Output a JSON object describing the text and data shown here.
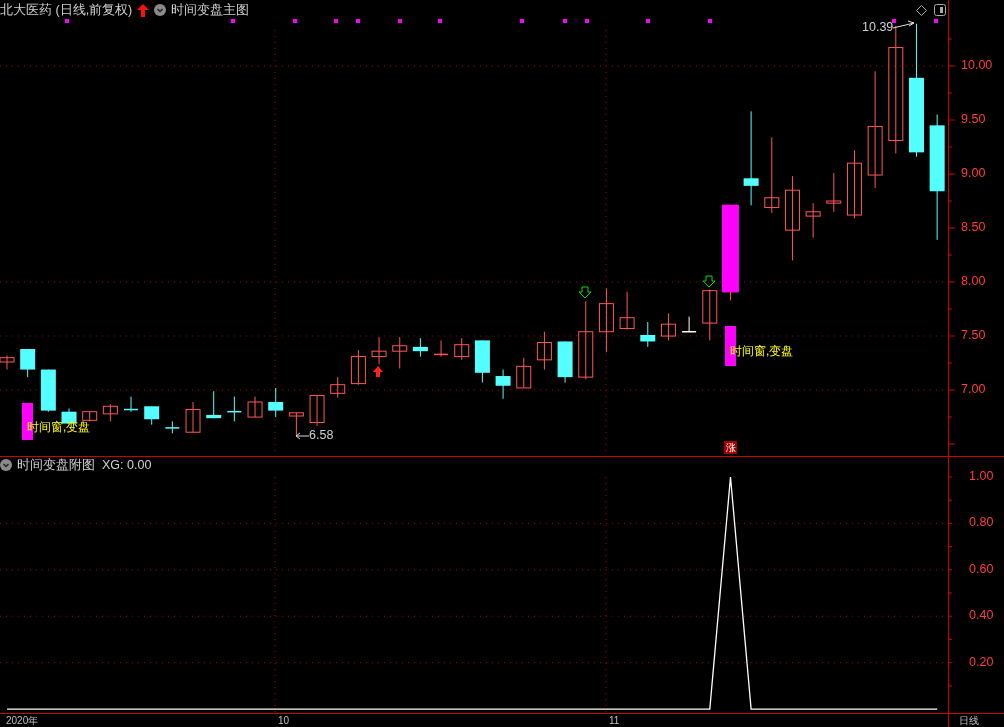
{
  "header": {
    "title": "北大医药 (日线,前复权)",
    "indicator": "时间变盘主图"
  },
  "price_chart": {
    "chart_data": {
      "type": "candlestick",
      "grid": true,
      "ohlc": [
        [
          7.26,
          7.32,
          7.19,
          7.3
        ],
        [
          7.38,
          7.38,
          7.12,
          7.19
        ],
        [
          7.19,
          7.19,
          6.8,
          6.81
        ],
        [
          6.8,
          6.83,
          6.69,
          6.69
        ],
        [
          6.72,
          6.8,
          6.71,
          6.8
        ],
        [
          6.78,
          6.87,
          6.71,
          6.85
        ],
        [
          6.82,
          6.94,
          6.8,
          6.81
        ],
        [
          6.85,
          6.85,
          6.68,
          6.73
        ],
        [
          6.65,
          6.71,
          6.6,
          6.64
        ],
        [
          6.61,
          6.89,
          6.61,
          6.82
        ],
        [
          6.77,
          6.99,
          6.74,
          6.74
        ],
        [
          6.8,
          6.94,
          6.71,
          6.79
        ],
        [
          6.75,
          6.94,
          6.75,
          6.89
        ],
        [
          6.89,
          7.02,
          6.75,
          6.81
        ],
        [
          6.76,
          6.79,
          6.58,
          6.79
        ],
        [
          6.7,
          6.95,
          6.67,
          6.95
        ],
        [
          6.97,
          7.12,
          6.93,
          7.05
        ],
        [
          7.06,
          7.37,
          7.05,
          7.31
        ],
        [
          7.31,
          7.49,
          7.24,
          7.36
        ],
        [
          7.36,
          7.49,
          7.2,
          7.41
        ],
        [
          7.4,
          7.48,
          7.31,
          7.36
        ],
        [
          7.32,
          7.46,
          7.31,
          7.33
        ],
        [
          7.31,
          7.48,
          7.28,
          7.42
        ],
        [
          7.46,
          7.46,
          7.07,
          7.16
        ],
        [
          7.13,
          7.19,
          6.92,
          7.04
        ],
        [
          7.02,
          7.3,
          7.02,
          7.22
        ],
        [
          7.28,
          7.54,
          7.19,
          7.44
        ],
        [
          7.45,
          7.45,
          7.07,
          7.12
        ],
        [
          7.12,
          7.82,
          7.1,
          7.54
        ],
        [
          7.54,
          7.94,
          7.35,
          7.8
        ],
        [
          7.57,
          7.91,
          7.56,
          7.67
        ],
        [
          7.51,
          7.63,
          7.4,
          7.45
        ],
        [
          7.5,
          7.71,
          7.46,
          7.61
        ],
        [
          7.54,
          7.68,
          7.54,
          7.54
        ],
        [
          7.62,
          7.93,
          7.46,
          7.92
        ],
        [
          7.91,
          8.71,
          7.83,
          8.71
        ],
        [
          8.96,
          9.58,
          8.71,
          8.89
        ],
        [
          8.69,
          9.34,
          8.64,
          8.78
        ],
        [
          8.48,
          8.98,
          8.2,
          8.85
        ],
        [
          8.61,
          8.73,
          8.41,
          8.65
        ],
        [
          8.73,
          9.01,
          8.65,
          8.75
        ],
        [
          8.62,
          9.22,
          8.59,
          9.1
        ],
        [
          8.99,
          9.95,
          8.87,
          9.44
        ],
        [
          9.31,
          10.37,
          9.19,
          10.17
        ],
        [
          9.89,
          10.39,
          9.16,
          9.2
        ],
        [
          9.45,
          9.55,
          8.39,
          8.84
        ]
      ],
      "ylim": [
        6.39,
        10.61
      ],
      "yticks": [
        {
          "value": 10,
          "label": "10.00"
        },
        {
          "value": 9.5,
          "label": "9.50"
        },
        {
          "value": 9,
          "label": "9.00"
        },
        {
          "value": 8.5,
          "label": "8.50"
        },
        {
          "value": 8,
          "label": "8.00"
        },
        {
          "value": 7.5,
          "label": "7.50"
        },
        {
          "value": 7,
          "label": "7.00"
        }
      ]
    }
  },
  "annotations": [
    {
      "kind": "high",
      "text": "10.39"
    },
    {
      "kind": "low",
      "text": "6.58"
    }
  ],
  "signals": [
    {
      "text": "时间窗,变盘"
    },
    {
      "text": "时间窗,变盘"
    }
  ],
  "badge": "涨",
  "sub_chart": {
    "title": "时间变盘附图",
    "reading": ": 0.00",
    "chart_data": {
      "type": "line",
      "grid": true,
      "series": [
        {
          "name": "XG",
          "color": "#ffffff",
          "values": [
            0,
            0,
            0,
            0,
            0,
            0,
            0,
            0,
            0,
            0,
            0,
            0,
            0,
            0,
            0,
            0,
            0,
            0,
            0,
            0,
            0,
            0,
            0,
            0,
            0,
            0,
            0,
            0,
            0,
            0,
            0,
            0,
            0,
            0,
            0,
            1,
            0,
            0,
            0,
            0,
            0,
            0,
            0,
            0,
            0,
            0
          ]
        }
      ],
      "ylim": [
        -0.017,
        1.086
      ],
      "yticks": [
        {
          "value": 1,
          "label": "1.00"
        },
        {
          "value": 0.8,
          "label": "0.80"
        },
        {
          "value": 0.6,
          "label": "0.60"
        },
        {
          "value": 0.4,
          "label": "0.40"
        },
        {
          "value": 0.2,
          "label": "0.20"
        }
      ]
    }
  },
  "time_axis": [
    "2020年",
    "10",
    "11",
    "日线"
  ]
}
